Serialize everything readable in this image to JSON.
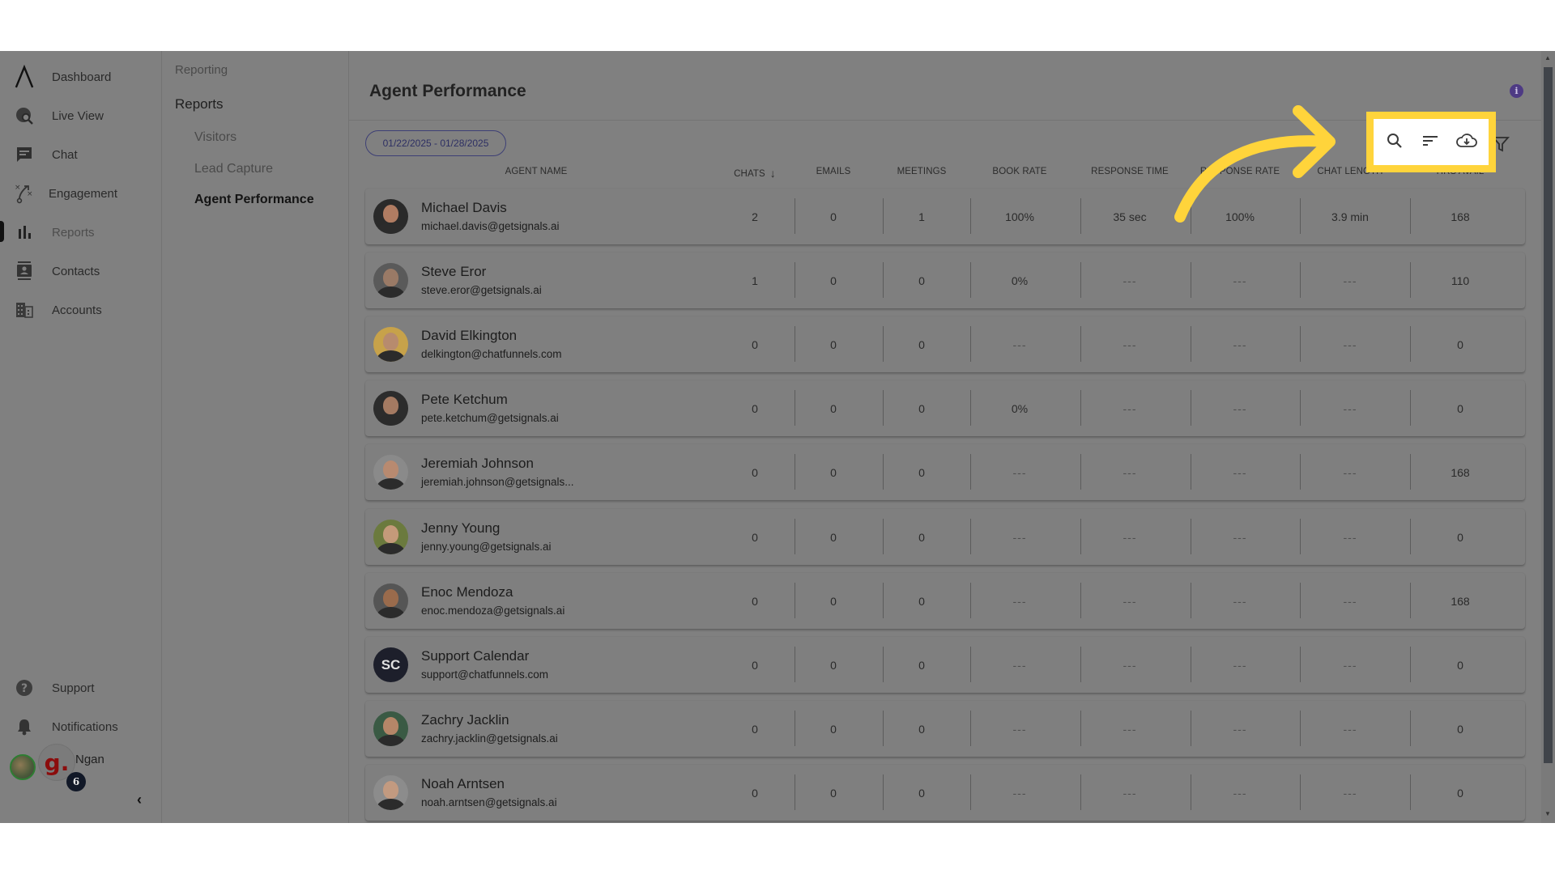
{
  "nav": {
    "items": [
      {
        "label": "Dashboard",
        "icon": "logo-icon"
      },
      {
        "label": "Live View",
        "icon": "globe-search-icon"
      },
      {
        "label": "Chat",
        "icon": "chat-icon"
      },
      {
        "label": "Engagement",
        "icon": "strategy-icon"
      },
      {
        "label": "Reports",
        "icon": "bar-chart-icon",
        "active": true
      },
      {
        "label": "Contacts",
        "icon": "contact-card-icon"
      },
      {
        "label": "Accounts",
        "icon": "building-icon"
      }
    ],
    "bottom": [
      {
        "label": "Support",
        "icon": "help-icon"
      },
      {
        "label": "Notifications",
        "icon": "bell-icon"
      }
    ],
    "user": {
      "name": "Ngan",
      "logo_letter": "g.",
      "badge_count": "6"
    },
    "collapse": "‹"
  },
  "subnav": {
    "section": "Reporting",
    "group": "Reports",
    "links": [
      {
        "label": "Visitors"
      },
      {
        "label": "Lead Capture"
      },
      {
        "label": "Agent Performance",
        "active": true
      }
    ]
  },
  "main": {
    "title": "Agent Performance",
    "date_range": "01/22/2025 - 01/28/2025",
    "toolbar": {
      "search": "search-icon",
      "sort": "sort-icon",
      "download": "cloud-download-icon",
      "filter": "filter-icon"
    },
    "columns": [
      "Agent Name",
      "Chats",
      "Emails",
      "Meetings",
      "Book Rate",
      "Response Time",
      "Response Rate",
      "Chat Length",
      "Hrs Avail"
    ],
    "sorted_column": "Chats",
    "sort_direction": "desc",
    "rows": [
      {
        "name": "Michael Davis",
        "email": "michael.davis@getsignals.ai",
        "values": [
          "2",
          "0",
          "1",
          "100%",
          "35 sec",
          "100%",
          "3.9 min",
          "168"
        ]
      },
      {
        "name": "Steve Eror",
        "email": "steve.eror@getsignals.ai",
        "values": [
          "1",
          "0",
          "0",
          "0%",
          "---",
          "---",
          "---",
          "110"
        ]
      },
      {
        "name": "David Elkington",
        "email": "delkington@chatfunnels.com",
        "values": [
          "0",
          "0",
          "0",
          "---",
          "---",
          "---",
          "---",
          "0"
        ]
      },
      {
        "name": "Pete Ketchum",
        "email": "pete.ketchum@getsignals.ai",
        "values": [
          "0",
          "0",
          "0",
          "0%",
          "---",
          "---",
          "---",
          "0"
        ]
      },
      {
        "name": "Jeremiah Johnson",
        "email": "jeremiah.johnson@getsignals...",
        "values": [
          "0",
          "0",
          "0",
          "---",
          "---",
          "---",
          "---",
          "168"
        ]
      },
      {
        "name": "Jenny Young",
        "email": "jenny.young@getsignals.ai",
        "values": [
          "0",
          "0",
          "0",
          "---",
          "---",
          "---",
          "---",
          "0"
        ]
      },
      {
        "name": "Enoc Mendoza",
        "email": "enoc.mendoza@getsignals.ai",
        "values": [
          "0",
          "0",
          "0",
          "---",
          "---",
          "---",
          "---",
          "168"
        ]
      },
      {
        "name": "Support Calendar",
        "email": "support@chatfunnels.com",
        "initials": "SC",
        "values": [
          "0",
          "0",
          "0",
          "---",
          "---",
          "---",
          "---",
          "0"
        ]
      },
      {
        "name": "Zachry Jacklin",
        "email": "zachry.jacklin@getsignals.ai",
        "values": [
          "0",
          "0",
          "0",
          "---",
          "---",
          "---",
          "---",
          "0"
        ]
      },
      {
        "name": "Noah Arntsen",
        "email": "noah.arntsen@getsignals.ai",
        "values": [
          "0",
          "0",
          "0",
          "---",
          "---",
          "---",
          "---",
          "0"
        ]
      }
    ]
  },
  "annotation": {
    "highlight_color": "#ffd43b",
    "target": "search, sort and download toolbar"
  },
  "colors": {
    "accent": "#3d3f75",
    "info": "#4e3a84",
    "overlay": "#808080"
  }
}
